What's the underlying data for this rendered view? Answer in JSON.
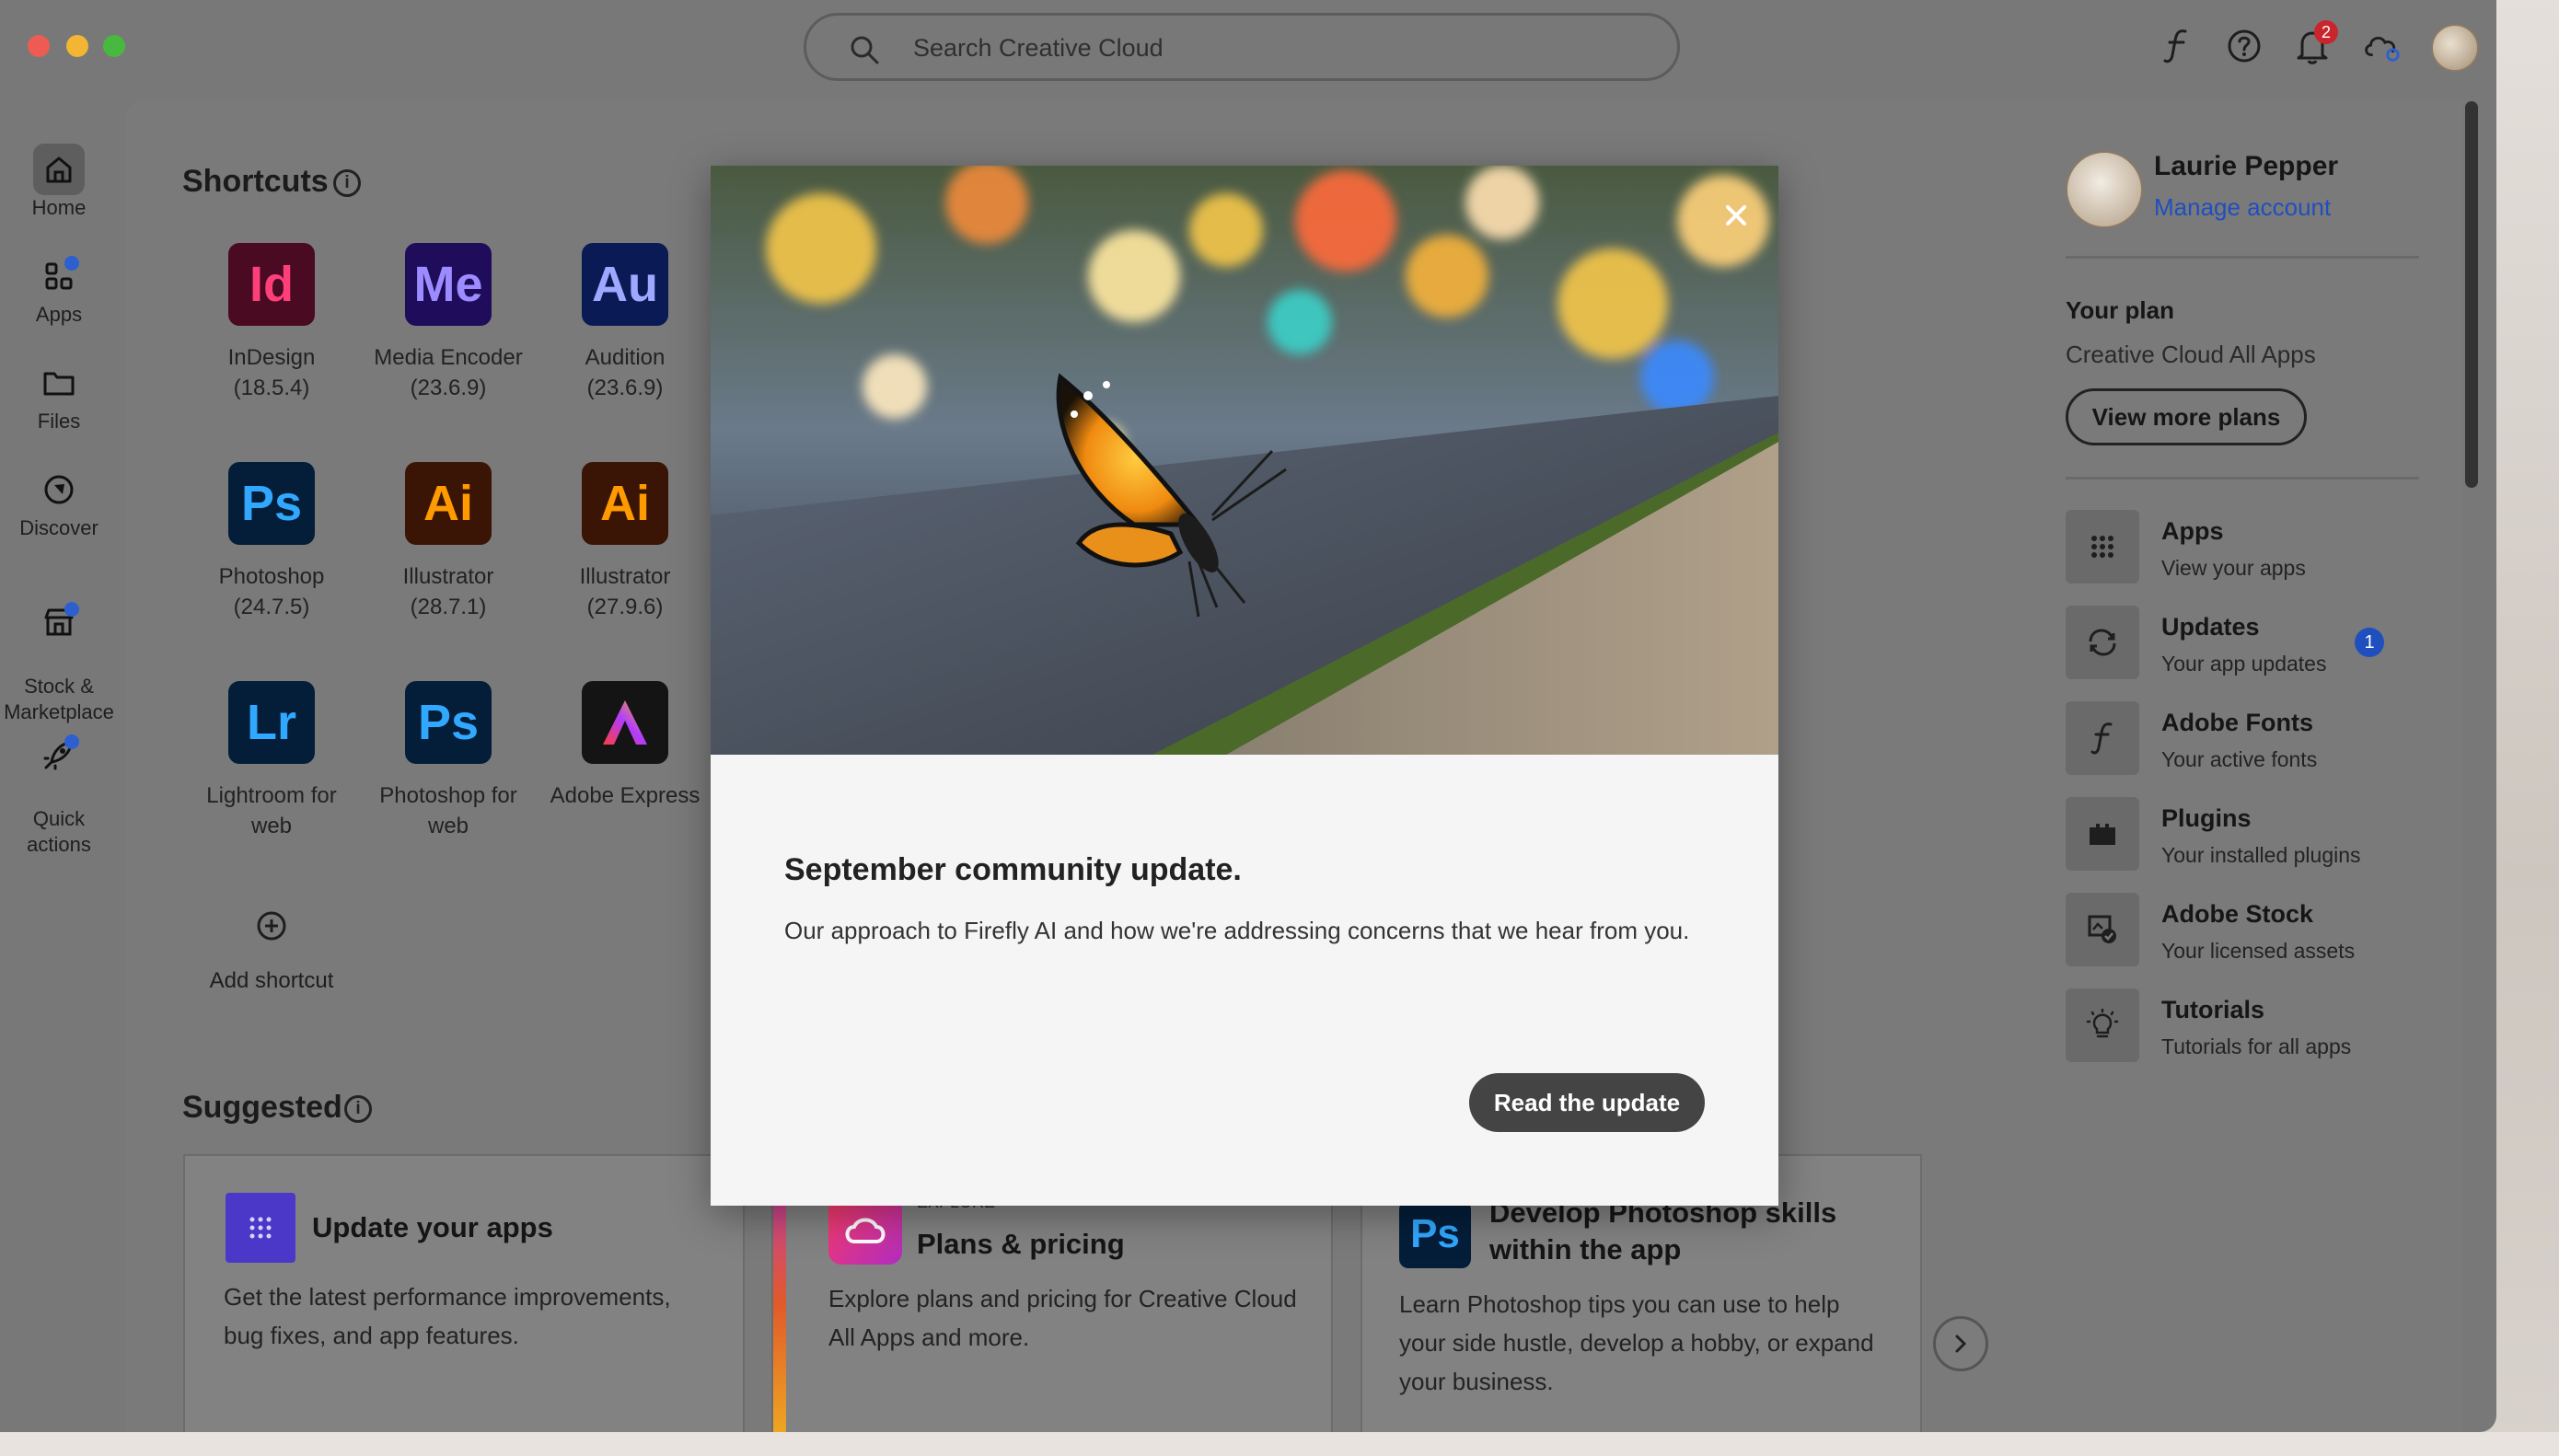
{
  "search": {
    "placeholder": "Search Creative Cloud"
  },
  "topbar": {
    "notification_count": "2"
  },
  "nav": {
    "home": "Home",
    "apps": "Apps",
    "files": "Files",
    "discover": "Discover",
    "stock": "Stock &\nMarketplace",
    "quick": "Quick\nactions"
  },
  "shortcuts": {
    "title": "Shortcuts",
    "apps": [
      {
        "abbr": "Id",
        "name": "InDesign\n(18.5.4)",
        "bg": "#4a0a22",
        "fg": "#ff3f7a"
      },
      {
        "abbr": "Me",
        "name": "Media Encoder\n(23.6.9)",
        "bg": "#1f0d5c",
        "fg": "#9c8cff"
      },
      {
        "abbr": "Au",
        "name": "Audition\n(23.6.9)",
        "bg": "#0a1a55",
        "fg": "#9fa8ff"
      },
      {
        "abbr": "Ps",
        "name": "Photoshop\n(24.7.5)",
        "bg": "#041e3a",
        "fg": "#31a8ff"
      },
      {
        "abbr": "Ai",
        "name": "Illustrator\n(28.7.1)",
        "bg": "#3a1505",
        "fg": "#ff9a00"
      },
      {
        "abbr": "Ai",
        "name": "Illustrator\n(27.9.6)",
        "bg": "#3a1505",
        "fg": "#ff9a00"
      },
      {
        "abbr": "Lr",
        "name": "Lightroom for\nweb",
        "bg": "#041e3a",
        "fg": "#31a8ff"
      },
      {
        "abbr": "Ps",
        "name": "Photoshop for\nweb",
        "bg": "#041e3a",
        "fg": "#31a8ff"
      },
      {
        "abbr": "A",
        "name": "Adobe Express",
        "bg": "#141414",
        "fg": "#ffffff"
      }
    ],
    "add_label": "Add shortcut"
  },
  "suggested": {
    "title": "Suggested",
    "cards": [
      {
        "title": "Update your apps",
        "desc": "Get the latest performance improvements,\nbug fixes, and app features."
      },
      {
        "eyebrow": "EXPLORE",
        "title": "Plans & pricing",
        "desc": "Explore plans and pricing for Creative Cloud\nAll Apps and more."
      },
      {
        "title": "Develop Photoshop skills\nwithin the app",
        "desc": "Learn Photoshop tips you can use to help\nyour side hustle, develop a hobby, or expand\nyour business."
      }
    ]
  },
  "account": {
    "name": "Laurie Pepper",
    "manage": "Manage account",
    "plan_label": "Your plan",
    "plan_name": "Creative Cloud All Apps",
    "view_plans": "View more plans"
  },
  "quicklinks": [
    {
      "title": "Apps",
      "sub": "View your apps"
    },
    {
      "title": "Updates",
      "sub": "Your app updates",
      "badge": "1"
    },
    {
      "title": "Adobe Fonts",
      "sub": "Your active fonts"
    },
    {
      "title": "Plugins",
      "sub": "Your installed plugins"
    },
    {
      "title": "Adobe Stock",
      "sub": "Your licensed assets"
    },
    {
      "title": "Tutorials",
      "sub": "Tutorials for all apps"
    }
  ],
  "modal": {
    "heading": "September community update.",
    "body": "Our approach to Firefly AI and how we're addressing concerns that we hear from you.",
    "cta": "Read the update"
  },
  "colors": {
    "accent_blue": "#1f4fbf",
    "badge_red": "#c9252d",
    "cta_bg": "#444444"
  }
}
